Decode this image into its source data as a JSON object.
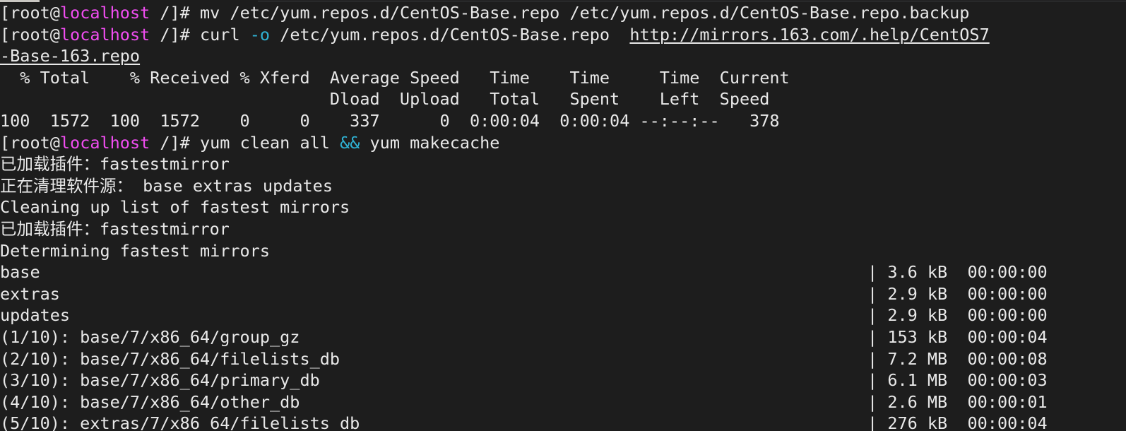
{
  "terminal": {
    "background_color": "#1d1d1d",
    "foreground_color": "#e8e8e8",
    "prompt_host_color": "#f24df2",
    "flag_color": "#2fb2d4",
    "prompt": {
      "open_bracket": "[",
      "user": "root",
      "at": "@",
      "host": "localhost",
      "space_path": " /",
      "close_bracket": "]# "
    },
    "lines": {
      "cmd1": "mv /etc/yum.repos.d/CentOS-Base.repo /etc/yum.repos.d/CentOS-Base.repo.backup",
      "cmd2_pre": "curl ",
      "cmd2_flag": "-o",
      "cmd2_mid": " /etc/yum.repos.d/CentOS-Base.repo  ",
      "cmd2_url": "http://mirrors.163.com/.help/CentOS7",
      "cmd2_url_wrap": "-Base-163.repo",
      "curl_header1": "  % Total    % Received % Xferd  Average Speed   Time    Time     Time  Current",
      "curl_header2": "                                 Dload  Upload   Total   Spent    Left  Speed",
      "curl_stats": "100  1572  100  1572    0     0    337      0  0:00:04  0:00:04 --:--:--   378",
      "cmd3_pre": "yum clean all ",
      "cmd3_op": "&&",
      "cmd3_post": " yum makecache",
      "out1": "已加载插件：fastestmirror",
      "out2": "正在清理软件源： base extras updates",
      "out3": "Cleaning up list of fastest mirrors",
      "out4": "已加载插件：fastestmirror",
      "out5": "Determining fastest mirrors"
    },
    "repo_rows": [
      {
        "name": "base",
        "sep": "|",
        "size": "3.6 kB",
        "time": "00:00:00"
      },
      {
        "name": "extras",
        "sep": "|",
        "size": "2.9 kB",
        "time": "00:00:00"
      },
      {
        "name": "updates",
        "sep": "|",
        "size": "2.9 kB",
        "time": "00:00:00"
      },
      {
        "name": "(1/10): base/7/x86_64/group_gz",
        "sep": "|",
        "size": "153 kB",
        "time": "00:00:04"
      },
      {
        "name": "(2/10): base/7/x86_64/filelists_db",
        "sep": "|",
        "size": "7.2 MB",
        "time": "00:00:08"
      },
      {
        "name": "(3/10): base/7/x86_64/primary_db",
        "sep": "|",
        "size": "6.1 MB",
        "time": "00:00:03"
      },
      {
        "name": "(4/10): base/7/x86_64/other_db",
        "sep": "|",
        "size": "2.6 MB",
        "time": "00:00:01"
      },
      {
        "name": "(5/10): extras/7/x86_64/filelists_db",
        "sep": "|",
        "size": "276 kB",
        "time": "00:00:04"
      }
    ]
  }
}
